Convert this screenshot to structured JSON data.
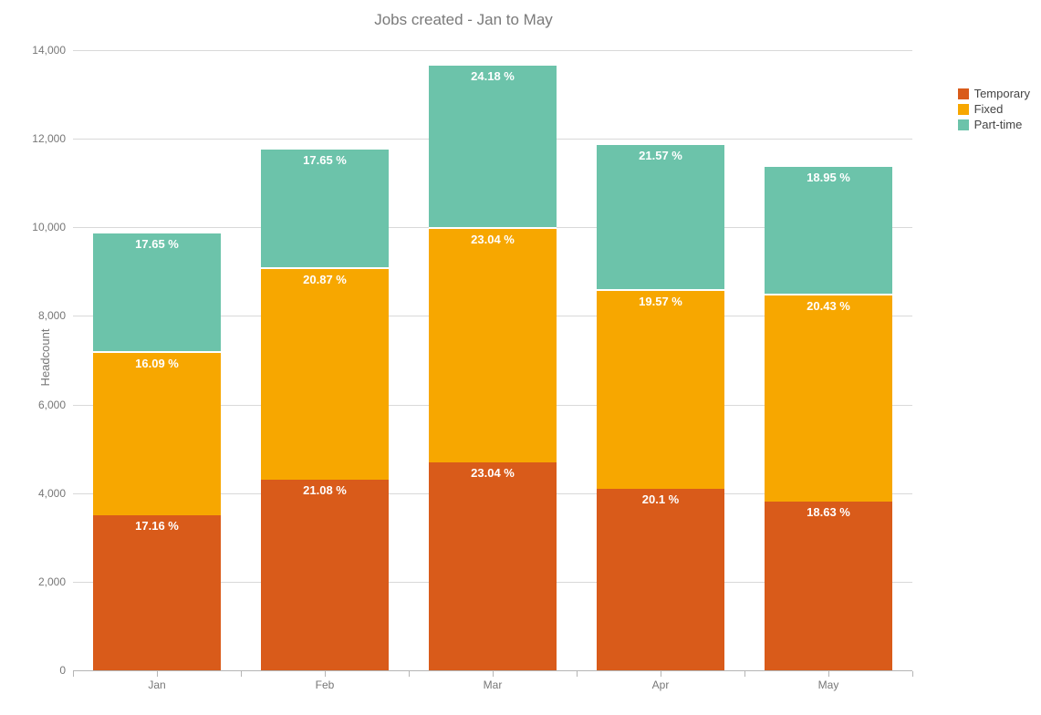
{
  "chart_data": {
    "type": "bar",
    "stacked": true,
    "title": "Jobs created - Jan to May",
    "xlabel": "",
    "ylabel": "Headcount",
    "categories": [
      "Jan",
      "Feb",
      "Mar",
      "Apr",
      "May"
    ],
    "ylim": [
      0,
      14000
    ],
    "y_ticks": [
      0,
      2000,
      4000,
      6000,
      8000,
      10000,
      12000,
      14000
    ],
    "y_tick_labels": [
      "0",
      "2,000",
      "4,000",
      "6,000",
      "8,000",
      "10,000",
      "12,000",
      "14,000"
    ],
    "series": [
      {
        "name": "Temporary",
        "color": "#d95b1a",
        "values": [
          3500,
          4300,
          4700,
          4100,
          3800
        ],
        "labels": [
          "17.16 %",
          "21.08 %",
          "23.04 %",
          "20.1 %",
          "18.63 %"
        ]
      },
      {
        "name": "Fixed",
        "color": "#f7a700",
        "values": [
          3700,
          4800,
          5300,
          4500,
          4700
        ],
        "labels": [
          "16.09 %",
          "20.87 %",
          "23.04 %",
          "19.57 %",
          "20.43 %"
        ]
      },
      {
        "name": "Part-time",
        "color": "#6cc3aa",
        "values": [
          2700,
          2700,
          3700,
          3300,
          2900
        ],
        "labels": [
          "17.65 %",
          "17.65 %",
          "24.18 %",
          "21.57 %",
          "18.95 %"
        ]
      }
    ],
    "legend_position": "right"
  }
}
